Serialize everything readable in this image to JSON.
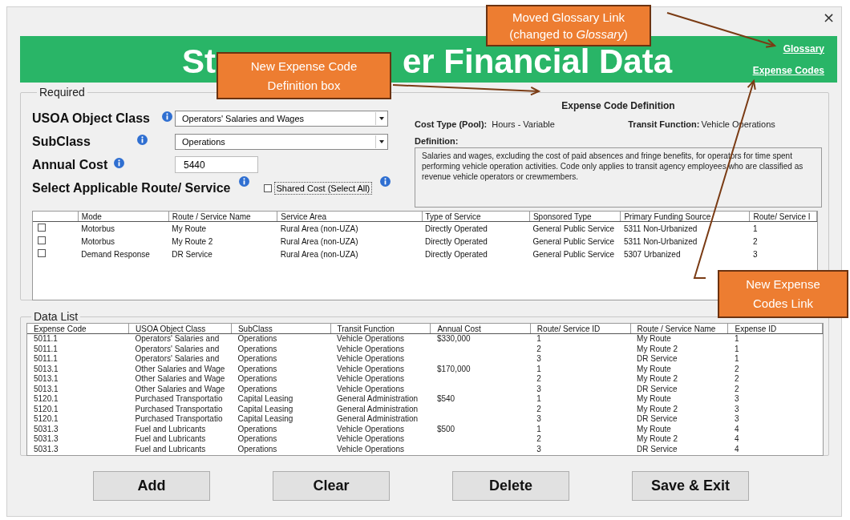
{
  "window": {
    "close": "×"
  },
  "header": {
    "title_parts": [
      "St",
      "er Financial Data"
    ],
    "links": [
      "Glossary",
      "Expense Codes"
    ]
  },
  "required": {
    "legend": "Required",
    "fields": [
      {
        "kind": "select",
        "label": "USOA Object Class",
        "value": "Operators' Salaries and Wages"
      },
      {
        "kind": "select",
        "label": "SubClass",
        "value": "Operations"
      },
      {
        "kind": "text",
        "label": "Annual Cost",
        "value": "5440"
      }
    ],
    "route_label": "Select Applicable Route/ Service",
    "shared_cost": {
      "label": "Shared Cost (Select All)",
      "checked": false
    },
    "definition": {
      "title": "Expense Code Definition",
      "cost_type_label": "Cost Type (Pool):",
      "cost_type": "Hours - Variable",
      "function_label": "Transit Function:",
      "function": "Vehicle Operations",
      "definition_label": "Definition:",
      "text": "Salaries and wages, excluding the cost of paid absences and fringe benefits, for operators for time spent performing vehicle operation activities. Code only applies to transit agency employees who are classified as revenue vehicle operators or crewmembers."
    },
    "routes": {
      "columns": [
        "Mode",
        "Route / Service Name",
        "Service Area",
        "Type of Service",
        "Sponsored Type",
        "Primary Funding Source",
        "Route/ Service I"
      ],
      "rows": [
        {
          "checked": false,
          "cells": [
            "Motorbus",
            "My Route",
            "Rural Area (non-UZA)",
            "Directly Operated",
            "General Public Service",
            "5311 Non-Urbanized",
            "1"
          ]
        },
        {
          "checked": false,
          "cells": [
            "Motorbus",
            "My Route 2",
            "Rural Area (non-UZA)",
            "Directly Operated",
            "General Public Service",
            "5311 Non-Urbanized",
            "2"
          ]
        },
        {
          "checked": false,
          "cells": [
            "Demand Response",
            "DR Service",
            "Rural Area (non-UZA)",
            "Directly Operated",
            "General Public Service",
            "5307 Urbanized",
            "3"
          ]
        }
      ]
    }
  },
  "data_list": {
    "legend": "Data List",
    "columns": [
      "Expense Code",
      "USOA Object Class",
      "SubClass",
      "Transit Function",
      "Annual Cost",
      "Route/ Service ID",
      "Route / Service Name",
      "Expense ID"
    ],
    "rows": [
      [
        "5011.1",
        "Operators' Salaries and",
        "Operations",
        "Vehicle Operations",
        "$330,000",
        "1",
        "My Route",
        "1"
      ],
      [
        "5011.1",
        "Operators' Salaries and",
        "Operations",
        "Vehicle Operations",
        null,
        "2",
        "My Route 2",
        "1"
      ],
      [
        "5011.1",
        "Operators' Salaries and",
        "Operations",
        "Vehicle Operations",
        null,
        "3",
        "DR Service",
        "1"
      ],
      [
        "5013.1",
        "Other Salaries and Wage",
        "Operations",
        "Vehicle Operations",
        "$170,000",
        "1",
        "My Route",
        "2"
      ],
      [
        "5013.1",
        "Other Salaries and Wage",
        "Operations",
        "Vehicle Operations",
        null,
        "2",
        "My Route 2",
        "2"
      ],
      [
        "5013.1",
        "Other Salaries and Wage",
        "Operations",
        "Vehicle Operations",
        null,
        "3",
        "DR Service",
        "2"
      ],
      [
        "5120.1",
        "Purchased Transportatio",
        "Capital Leasing",
        "General Administration",
        "$540",
        "1",
        "My Route",
        "3"
      ],
      [
        "5120.1",
        "Purchased Transportatio",
        "Capital Leasing",
        "General Administration",
        null,
        "2",
        "My Route 2",
        "3"
      ],
      [
        "5120.1",
        "Purchased Transportatio",
        "Capital Leasing",
        "General Administration",
        null,
        "3",
        "DR Service",
        "3"
      ],
      [
        "5031.3",
        "Fuel and Lubricants",
        "Operations",
        "Vehicle Operations",
        "$500",
        "1",
        "My Route",
        "4"
      ],
      [
        "5031.3",
        "Fuel and Lubricants",
        "Operations",
        "Vehicle Operations",
        null,
        "2",
        "My Route 2",
        "4"
      ],
      [
        "5031.3",
        "Fuel and Lubricants",
        "Operations",
        "Vehicle Operations",
        null,
        "3",
        "DR Service",
        "4"
      ]
    ]
  },
  "buttons": [
    "Add",
    "Clear",
    "Delete",
    "Save & Exit"
  ],
  "callouts": [
    {
      "text": "Moved Glossary Link (changed to *Glossary*)"
    },
    {
      "text": "New Expense Code Definition box"
    },
    {
      "text": "New Expense Codes Link"
    }
  ]
}
